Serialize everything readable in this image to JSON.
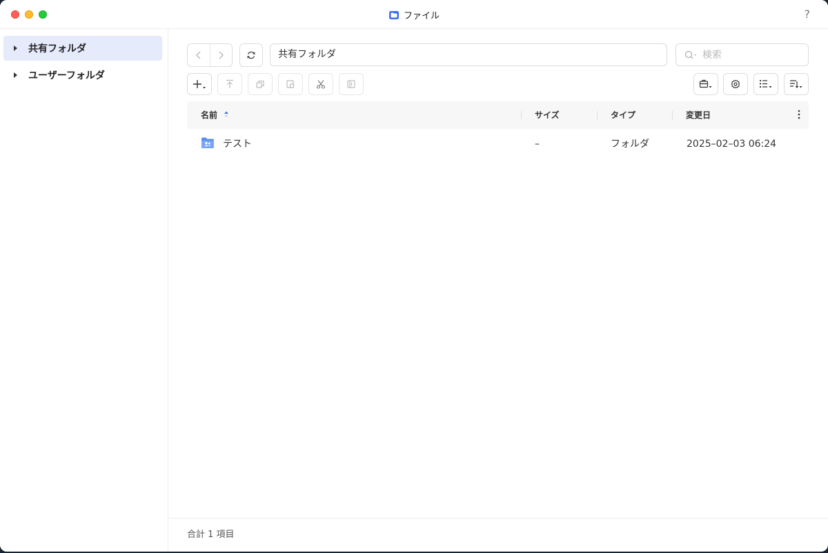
{
  "window": {
    "title": "ファイル"
  },
  "help_label": "?",
  "sidebar": {
    "items": [
      {
        "label": "共有フォルダ"
      },
      {
        "label": "ユーザーフォルダ"
      }
    ]
  },
  "toolbar": {
    "path": "共有フォルダ",
    "search_placeholder": "検索"
  },
  "table": {
    "columns": [
      "名前",
      "サイズ",
      "タイプ",
      "変更日"
    ],
    "rows": [
      {
        "name": "テスト",
        "size": "–",
        "type": "フォルダ",
        "modified": "2025–02–03 06:24"
      }
    ]
  },
  "footer": {
    "summary": "合計 1 項目"
  },
  "colors": {
    "accent": "#3b6ff0",
    "selected_bg": "#e5ebfb",
    "folder": "#5b8def"
  }
}
